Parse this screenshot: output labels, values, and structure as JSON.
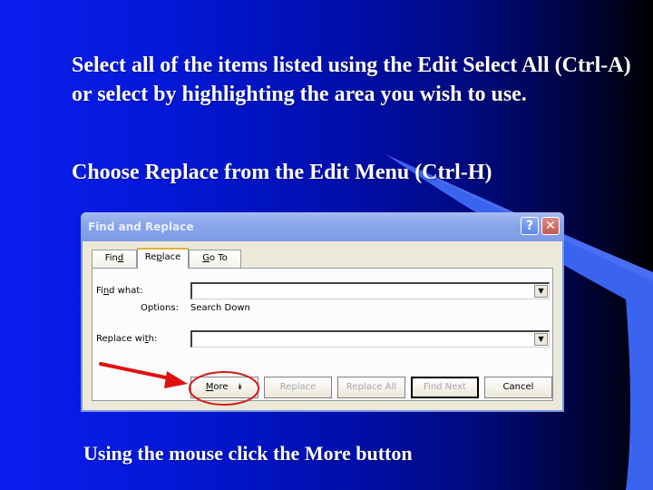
{
  "slide": {
    "paragraphs": [
      "Select all of the items listed using the Edit Select All (Ctrl-A) or select by highlighting the area you wish to use.",
      "Choose Replace from the Edit Menu (Ctrl-H)",
      "Using the mouse click the More button"
    ],
    "colors": {
      "background_start": "#0a1ef0",
      "background_end": "#000000",
      "swoosh": "#3a63f0",
      "text": "#ffffff",
      "annotation": "#e01010"
    }
  },
  "dialog": {
    "title": "Find and Replace",
    "help_icon": "question-mark",
    "close_icon": "x",
    "tabs": [
      {
        "label_pre": "Fin",
        "label_u": "d",
        "label_post": "",
        "active": false
      },
      {
        "label_pre": "Re",
        "label_u": "p",
        "label_post": "lace",
        "active": true
      },
      {
        "label_pre": "",
        "label_u": "G",
        "label_post": "o To",
        "active": false
      }
    ],
    "find_what": {
      "label_pre": "Fi",
      "label_u": "n",
      "label_post": "d what:",
      "value": ""
    },
    "options_label": "Options:",
    "options_value": "Search Down",
    "replace_with": {
      "label_pre": "Replace wi",
      "label_u": "t",
      "label_post": "h:",
      "value": ""
    },
    "dropdown_arrow": "▼",
    "buttons": {
      "more_u": "M",
      "more_rest": "ore",
      "more_icon": "↡",
      "replace": "Replace",
      "replace_all": "Replace All",
      "find_next": "Find Next",
      "cancel": "Cancel"
    }
  }
}
